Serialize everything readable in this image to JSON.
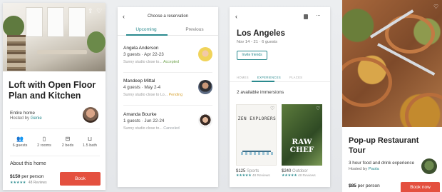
{
  "listing": {
    "title": "Loft with Open Floor Plan and Kitchen",
    "home_type": "Entire home",
    "hosted_by": "Hosted by",
    "host_name": "Genie",
    "amenities": [
      {
        "icon": "guests-icon",
        "label": "6 guests"
      },
      {
        "icon": "door-icon",
        "label": "2 rooms"
      },
      {
        "icon": "bed-icon",
        "label": "2 beds"
      },
      {
        "icon": "bath-icon",
        "label": "1.5 bath"
      }
    ],
    "about_heading": "About this home",
    "price": "$150",
    "price_unit": "per person",
    "stars": "★★★★★",
    "reviews": "48 Reviews",
    "book_label": "Book"
  },
  "reservations": {
    "header_title": "Choose a reservation",
    "tabs": [
      "Upcoming",
      "Previous"
    ],
    "items": [
      {
        "name": "Angela Anderson",
        "guests": "3 guests · Apr 22-23",
        "desc": "Sunny studio close to...",
        "status": "Accepted"
      },
      {
        "name": "Mandeep Mittal",
        "guests": "4 guests · May 2-4",
        "desc": "Sunny studio close to Lo...",
        "status": "Pending"
      },
      {
        "name": "Amanda Bourke",
        "guests": "1 guests · Jun 22-24",
        "desc": "Sunny studio close to...",
        "status": "Canceled"
      }
    ]
  },
  "trip": {
    "city": "Los Angeles",
    "dates": "Nov 14 - 21 · 6 guests",
    "invite_label": "Invite friends",
    "tabs": [
      "HOMES",
      "EXPERIENCES",
      "PLACES"
    ],
    "available": "2 available immersions",
    "experiences": [
      {
        "cover_text": "ZEN EXPLORERS",
        "price": "$125",
        "category": "Sports",
        "stars": "★★★★★",
        "reviews": "48 Reviews"
      },
      {
        "cover_text": "RAW CHEF",
        "price": "$240",
        "category": "Outdoor",
        "stars": "★★★★★",
        "reviews": "48 Reviews"
      }
    ]
  },
  "experience": {
    "title": "Pop-up Restaurant Tour",
    "description": "3 hour food and drink experience",
    "hosted_by": "Hosted by",
    "host_name": "Paola",
    "price": "$85",
    "price_unit": "per person",
    "book_label": "Book now"
  },
  "colors": {
    "accent": "#2a8a8e",
    "book": "#e4503f",
    "accepted": "#6fa34d",
    "pending": "#d8a73b"
  }
}
